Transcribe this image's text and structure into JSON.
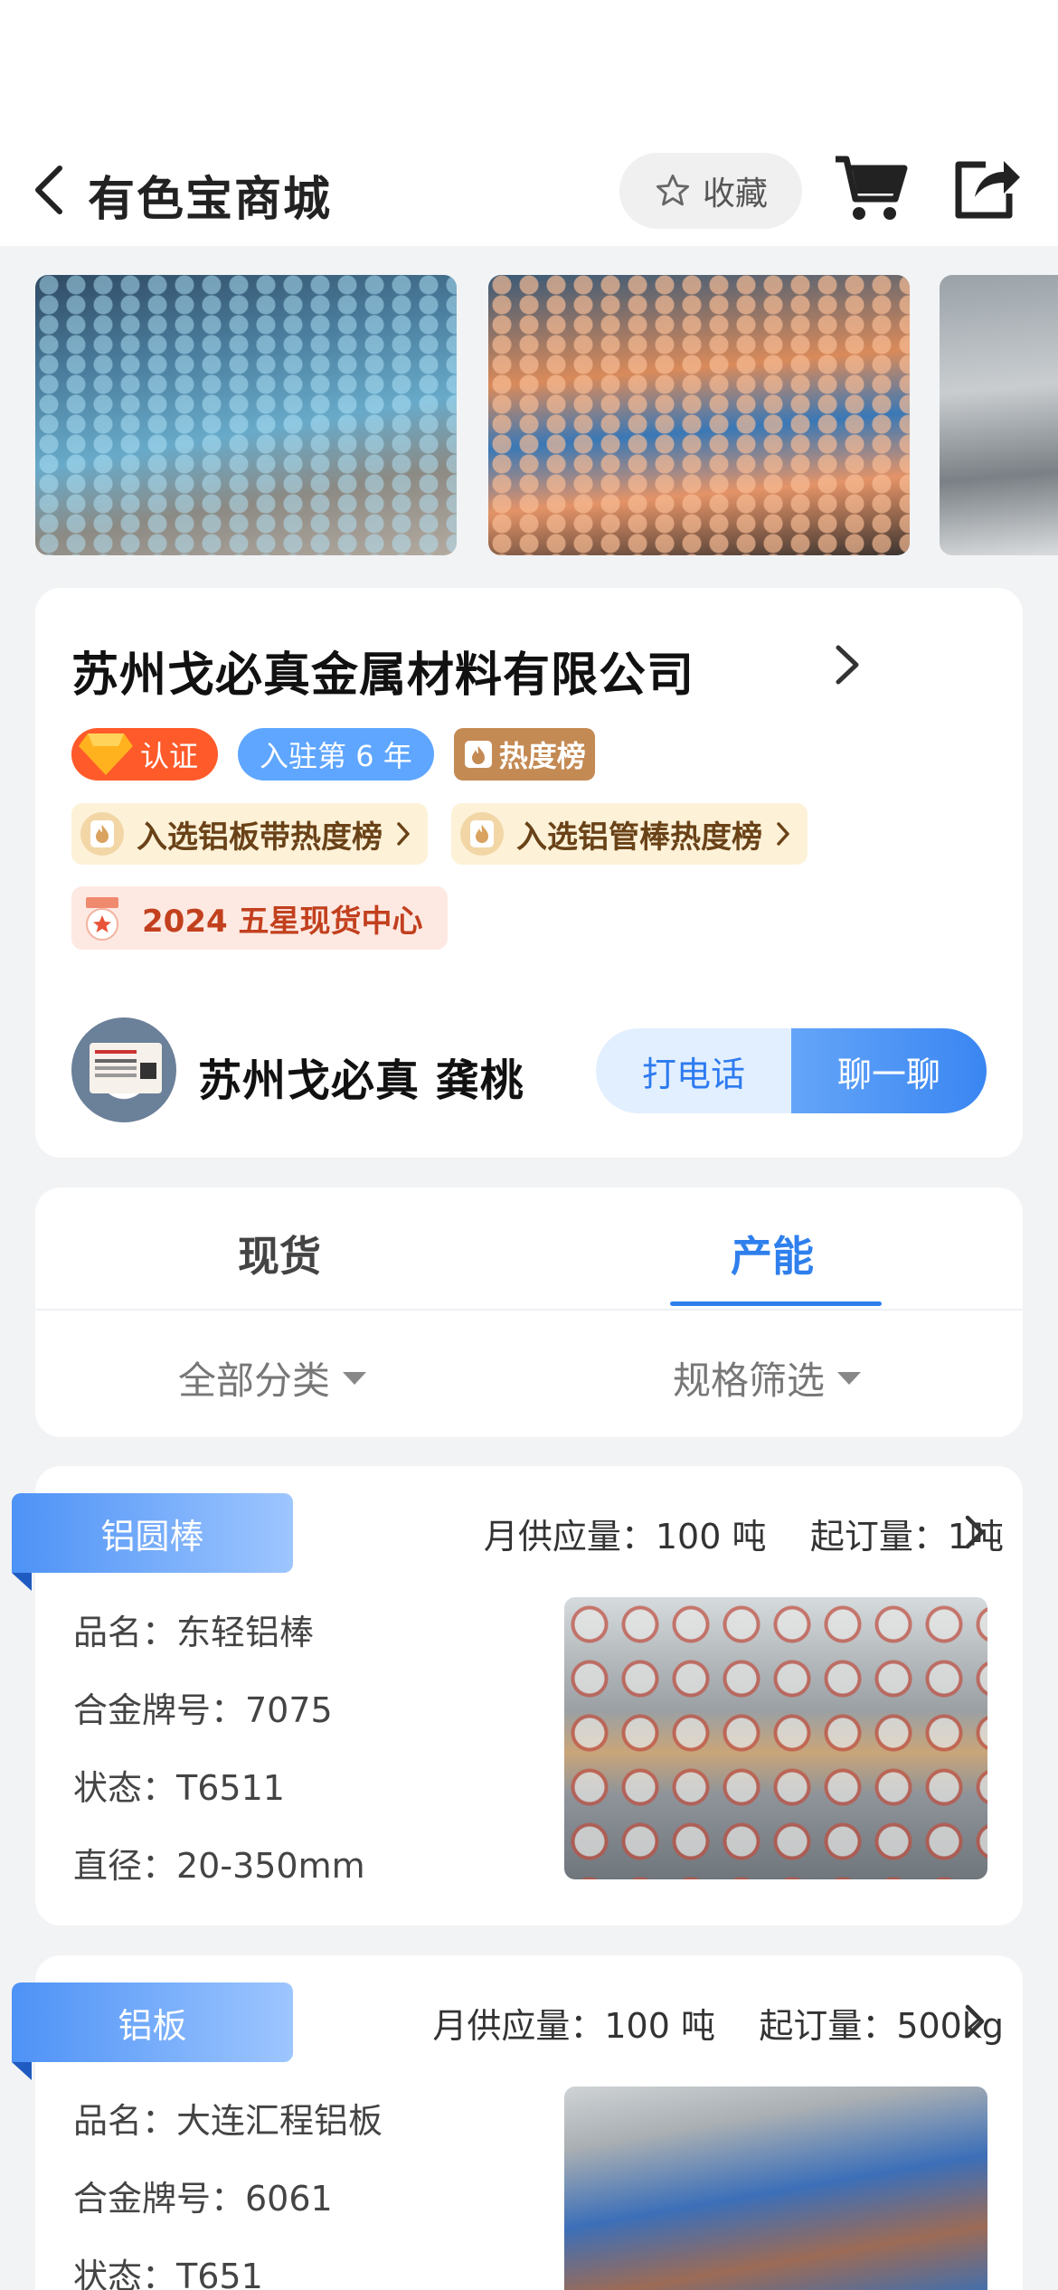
{
  "header": {
    "title": "有色宝商城",
    "favorite_label": "收藏"
  },
  "gallery": {
    "photos": [
      "aluminum-rod-stock",
      "copper-rod-stock",
      "aluminum-plate-stock"
    ]
  },
  "company": {
    "name": "苏州戈必真金属材料有限公司",
    "badges": {
      "certified": "认证",
      "years": "入驻第 6 年",
      "hot": "热度榜"
    },
    "hot_lists": [
      "入选铝板带热度榜",
      "入选铝管棒热度榜"
    ],
    "award": "2024 五星现货中心",
    "contact_name": "苏州戈必真 龚桃",
    "call_label": "打电话",
    "chat_label": "聊一聊"
  },
  "tabs": {
    "items": [
      {
        "label": "现货"
      },
      {
        "label": "产能"
      }
    ],
    "active_index": 1,
    "filters": [
      "全部分类",
      "规格筛选"
    ]
  },
  "products": [
    {
      "category": "铝圆棒",
      "supply": "月供应量：100 吨",
      "moq": "起订量：1吨",
      "attrs": [
        "品名：东轻铝棒",
        "合金牌号：7075",
        "状态：T6511",
        "直径：20-350mm"
      ]
    },
    {
      "category": "铝板",
      "supply": "月供应量：100 吨",
      "moq": "起订量：500kg",
      "attrs": [
        "品名：大连汇程铝板",
        "合金牌号：6061",
        "状态：T651"
      ]
    }
  ],
  "colors": {
    "accent": "#2f80ed",
    "cert": "#ff5a2a",
    "hot": "#c48a54"
  }
}
